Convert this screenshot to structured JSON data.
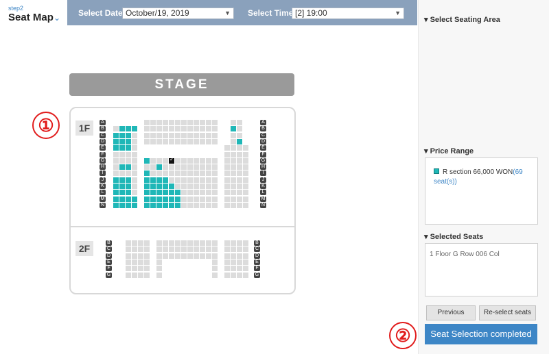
{
  "header": {
    "step_label": "step2",
    "step_title": "Seat Map",
    "select_date_label": "Select Date",
    "select_date_value": "October/19, 2019",
    "select_time_label": "Select Time",
    "select_time_value": "[2] 19:00"
  },
  "stage": {
    "label": "STAGE"
  },
  "markers": {
    "one": "①",
    "two": "②"
  },
  "floors": {
    "first": {
      "label": "1F",
      "rows": [
        "A",
        "B",
        "C",
        "D",
        "E",
        "F",
        "G",
        "H",
        "I",
        "J",
        "K",
        "L",
        "M",
        "N"
      ]
    },
    "second": {
      "label": "2F",
      "rows": [
        "B",
        "C",
        "D",
        "E",
        "F",
        "G"
      ]
    }
  },
  "panel": {
    "seating_area_title": "Select Seating Area",
    "price_range_title": "Price Range",
    "price_text": "R section 66,000 WON",
    "price_count": "(69 seat(s))",
    "selected_seats_title": "Selected Seats",
    "selected_seats_value": "1 Floor G Row 006 Col",
    "previous_label": "Previous",
    "reselect_label": "Re-select seats",
    "complete_label": "Seat Selection completed"
  },
  "colors": {
    "topbar": "#8aa1bc",
    "available_seat": "#1fb7b7",
    "unavailable_seat": "#dcdcdc",
    "primary_button": "#3d86c6",
    "marker": "#e11c1c"
  }
}
